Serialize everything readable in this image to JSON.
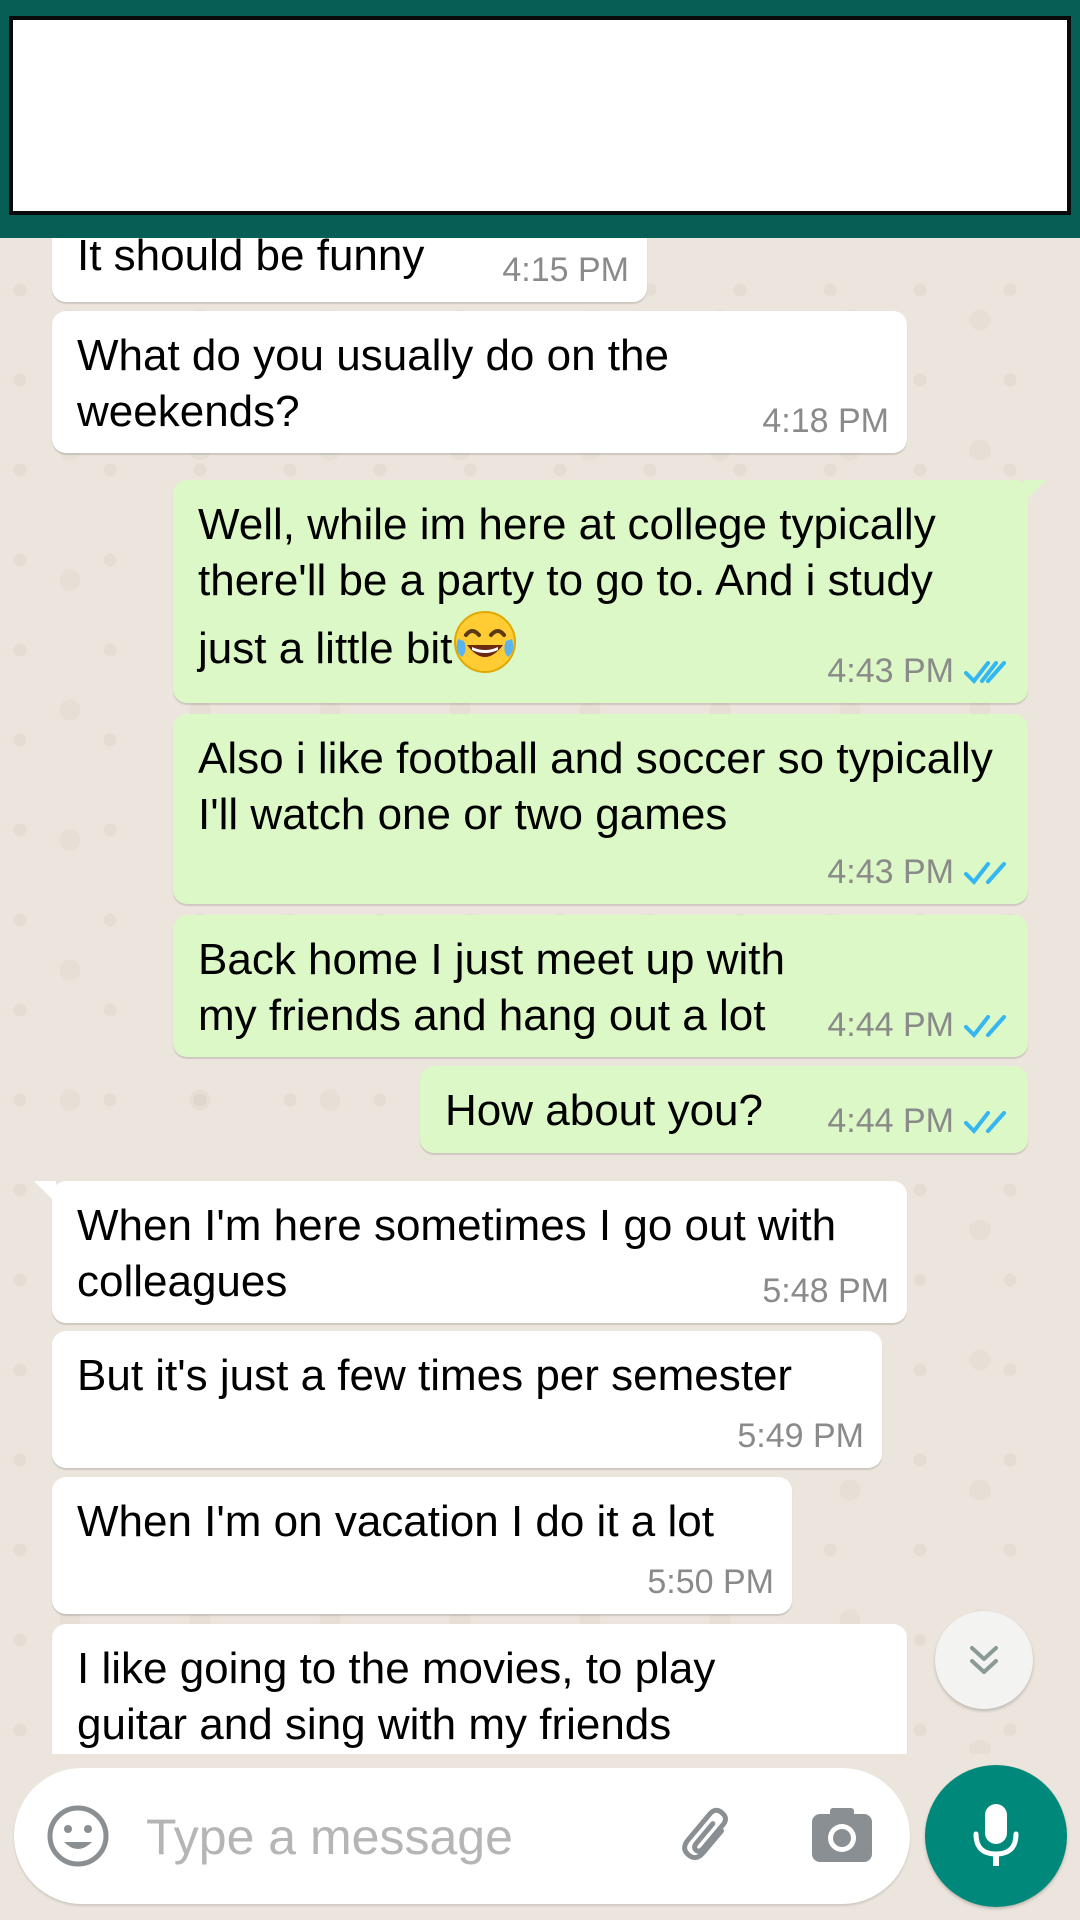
{
  "chat": {
    "messages": [
      {
        "dir": "in",
        "text": "It should be funny",
        "time": "4:15 PM"
      },
      {
        "dir": "in",
        "text": "What do you usually do on the weekends?",
        "time": "4:18 PM"
      },
      {
        "dir": "out",
        "text": "Well, while im here at college typically there'll be a party to go to. And i study just a little bit",
        "time": "4:43 PM",
        "read": true
      },
      {
        "dir": "out",
        "text": "Also i like football and soccer so typically I'll watch one or two games",
        "time": "4:43 PM",
        "read": true
      },
      {
        "dir": "out",
        "text": "Back home I just meet up with my friends and hang out a lot",
        "time": "4:44 PM",
        "read": true
      },
      {
        "dir": "out",
        "text": "How about you?",
        "time": "4:44 PM",
        "read": true
      },
      {
        "dir": "in",
        "text": "When I'm here sometimes I go out with colleagues",
        "time": "5:48 PM"
      },
      {
        "dir": "in",
        "text": "But it's just a few times per semester",
        "time": "5:49 PM"
      },
      {
        "dir": "in",
        "text": "When I'm on vacation I do it a lot",
        "time": "5:50 PM"
      },
      {
        "dir": "in",
        "text": "I like going to the movies, to play guitar and sing with my friends",
        "time": ""
      }
    ]
  },
  "emoji": {
    "laugh": "face-with-tears-of-joy"
  },
  "composer": {
    "placeholder": "Type a message"
  },
  "icons": {
    "emoji": "smiley-icon",
    "attach": "paperclip-icon",
    "camera": "camera-icon",
    "mic": "mic-icon",
    "scroll": "double-chevron-down-icon",
    "read_receipt": "double-check-icon"
  },
  "colors": {
    "header": "#075E54",
    "incoming_bubble": "#FFFFFF",
    "outgoing_bubble": "#DCF8C6",
    "read_ticks": "#34B7F1",
    "mic_button": "#00897B",
    "background": "#ECE5DD"
  }
}
